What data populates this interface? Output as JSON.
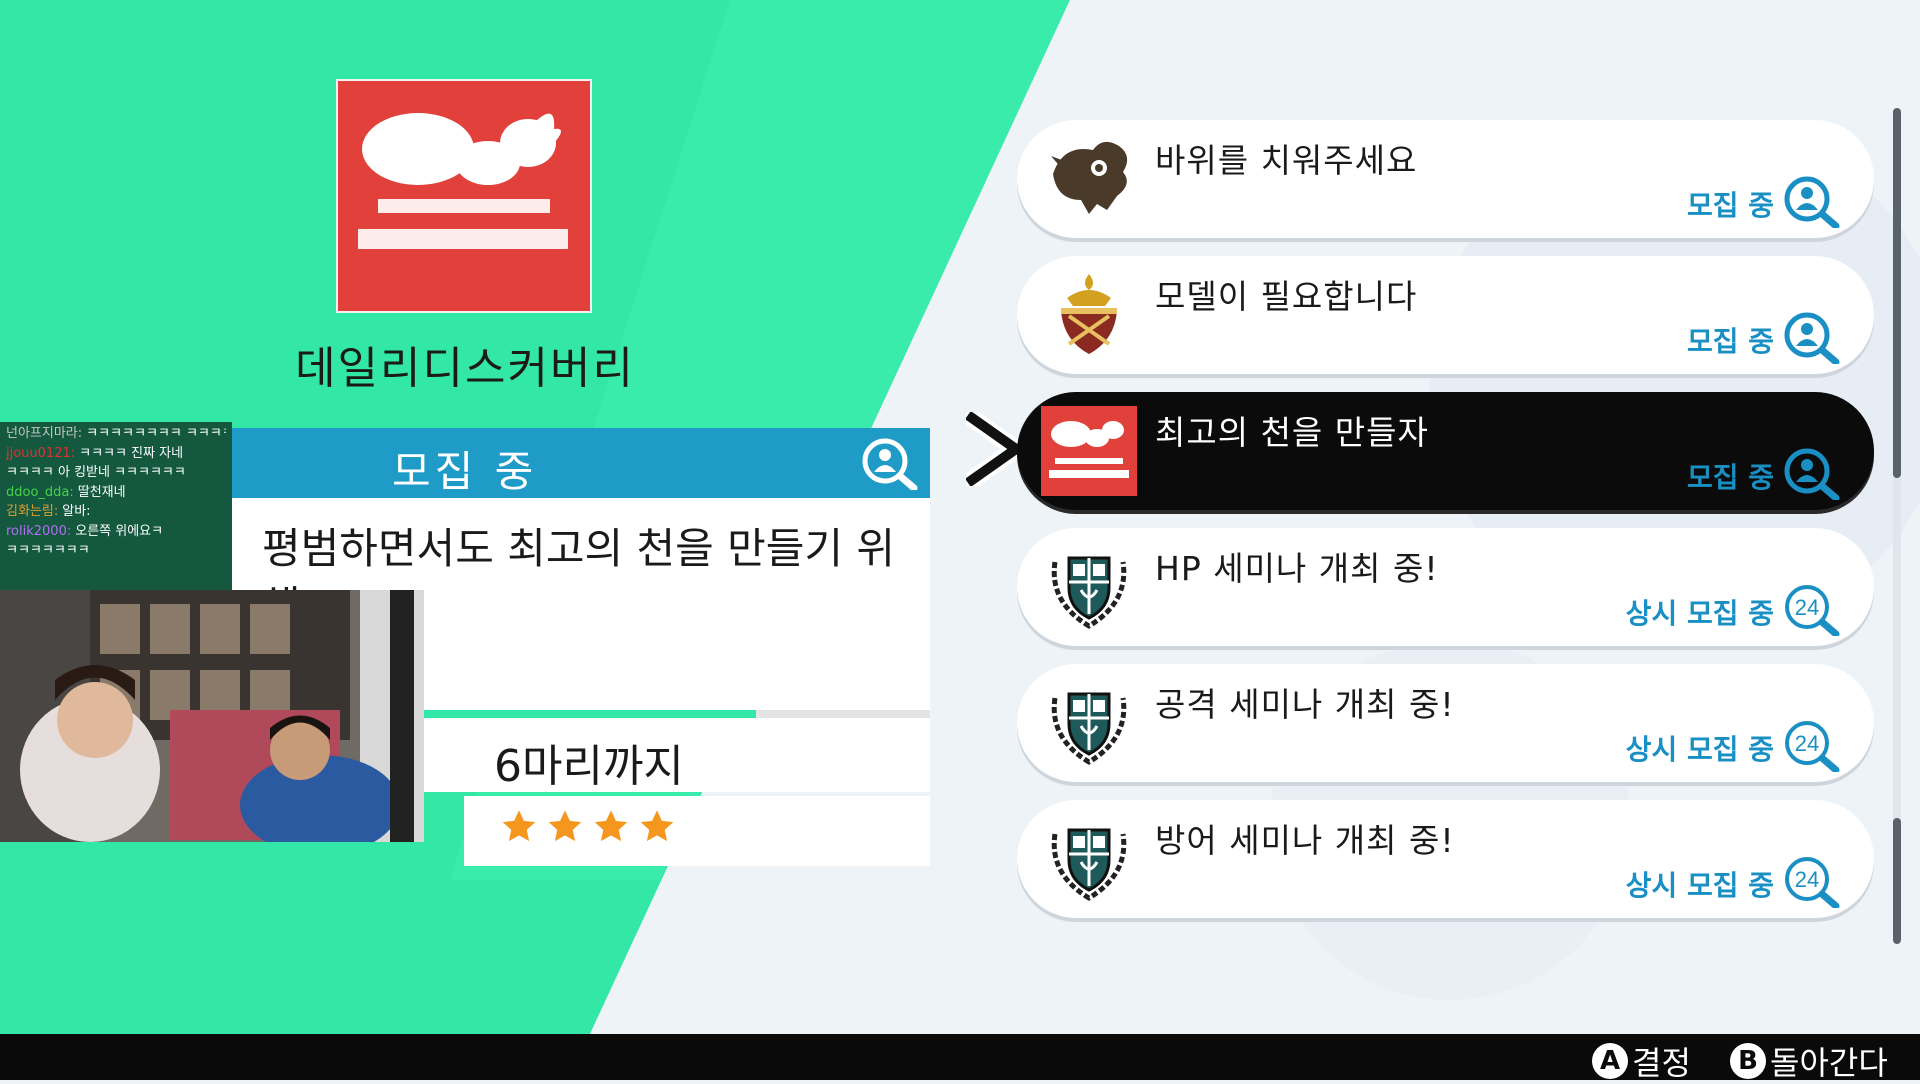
{
  "colors": {
    "accent_green": "#33e8a6",
    "header_blue": "#1f9bc8",
    "status_blue": "#1a8fc4",
    "client_red": "#e2403b",
    "star_orange": "#f5961f"
  },
  "client": {
    "logo_icon": "cloud-bird-logo",
    "name": "데일리디스커버리"
  },
  "detail": {
    "header": "모집 중",
    "header_icon": "search-person-icon",
    "description": "평범하면서도 최고의 천을 만들기 위해",
    "description_tail": "!",
    "limit": "6마리까지",
    "stars": 4,
    "progress_fraction": 0.75
  },
  "chat": [
    {
      "user": "넌아프지마라:",
      "text": "ㅋㅋㅋㅋㅋㅋㅋㅋ ㅋㅋㅋㅋㅋㅋㅋ",
      "color": "#c7c7c7"
    },
    {
      "user": "jjouu0121:",
      "text": "ㅋㅋㅋㅋ 진짜 자네",
      "color": "#e03030"
    },
    {
      "user": "",
      "text": "ㅋㅋㅋㅋ 아 킹받네 ㅋㅋㅋㅋㅋㅋ",
      "color": "#ffffff"
    },
    {
      "user": "ddoo_dda:",
      "text": "딸천재네",
      "color": "#48d048"
    },
    {
      "user": "김화는림:",
      "text": "알바:",
      "color": "#e0a030"
    },
    {
      "user": "rolik2000:",
      "text": "오른쪽 위에요ㅋ",
      "color": "#b070f0"
    },
    {
      "user": "",
      "text": "ㅋㅋㅋㅋㅋㅋㅋ",
      "color": "#ffffff"
    }
  ],
  "requests": [
    {
      "title": "바위를 치워주세요",
      "status": "모집 중",
      "status_icon": "search-person-icon",
      "thumb": "dragon-emblem-icon",
      "selected": false
    },
    {
      "title": "모델이 필요합니다",
      "status": "모집 중",
      "status_icon": "search-person-icon",
      "thumb": "ornate-crest-icon",
      "selected": false
    },
    {
      "title": "최고의 천을 만들자",
      "status": "모집 중",
      "status_icon": "search-person-icon",
      "thumb": "cloud-bird-logo",
      "selected": true
    },
    {
      "title": "HP 세미나 개최 중!",
      "status": "상시 모집 중",
      "status_icon": "search-24-icon",
      "thumb": "academy-crest-icon",
      "selected": false
    },
    {
      "title": "공격 세미나 개최 중!",
      "status": "상시 모집 중",
      "status_icon": "search-24-icon",
      "thumb": "academy-crest-icon",
      "selected": false
    },
    {
      "title": "방어 세미나 개최 중!",
      "status": "상시 모집 중",
      "status_icon": "search-24-icon",
      "thumb": "academy-crest-icon",
      "selected": false
    }
  ],
  "status_icon_24_text": "24",
  "footer": {
    "a_button": "A",
    "a_label": "결정",
    "b_button": "B",
    "b_label": "돌아간다"
  }
}
